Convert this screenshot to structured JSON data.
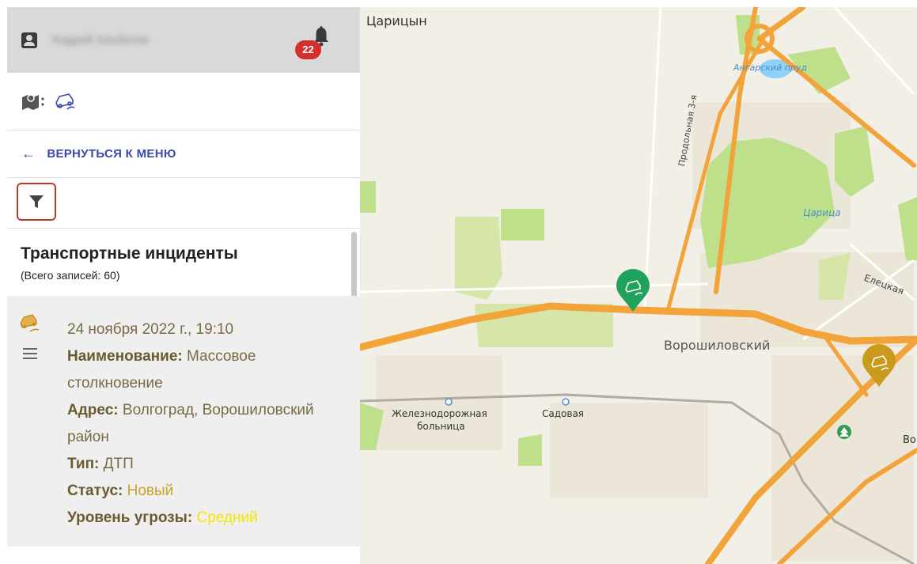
{
  "header": {
    "user_name": "Андрей Альбатов",
    "notification_count": "22"
  },
  "nav": {
    "back_label": "ВЕРНУТЬСЯ К МЕНЮ"
  },
  "list": {
    "title": "Транспортные инциденты",
    "count_text": "(Всего записей: 60)"
  },
  "incident": {
    "datetime": "24 ноября 2022 г., 19:10",
    "name_label": "Наименование:",
    "name_value": "Массовое столкновение",
    "address_label": "Адрес:",
    "address_value": "Волгоград, Ворошиловский район",
    "type_label": "Тип:",
    "type_value": "ДТП",
    "status_label": "Статус:",
    "status_value": "Новый",
    "threat_label": "Уровень угрозы:",
    "threat_value": "Средний"
  },
  "map": {
    "labels": {
      "city": "Царицын",
      "pond": "Ангарский пруд",
      "street_prodolnaya": "Продольная 3-я",
      "river": "Царица",
      "street_eletskaya": "Елецкая",
      "district": "Ворошиловский",
      "station_1_line1": "Железнодорожная",
      "station_1_line2": "больница",
      "station_2": "Садовая",
      "edge_text": "Во"
    },
    "colors": {
      "land": "#f2efe6",
      "park": "#bfe08a",
      "highway": "#f2a33a",
      "water": "#8fd0f5",
      "marker_green": "#1fa35c",
      "marker_gold": "#c99a1e",
      "accent_nav": "#3949ab",
      "badge": "#d32f2f"
    },
    "icons": [
      "incident-marker-icon",
      "tree-icon",
      "metro-station-icon"
    ]
  }
}
